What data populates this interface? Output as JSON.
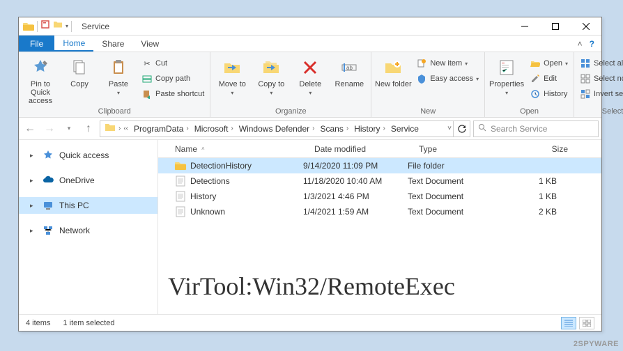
{
  "window": {
    "title": "Service"
  },
  "tabs": {
    "file": "File",
    "home": "Home",
    "share": "Share",
    "view": "View"
  },
  "ribbon": {
    "clipboard": {
      "label": "Clipboard",
      "pin": "Pin to Quick access",
      "copy": "Copy",
      "paste": "Paste",
      "cut": "Cut",
      "copypath": "Copy path",
      "pasteshortcut": "Paste shortcut"
    },
    "organize": {
      "label": "Organize",
      "moveto": "Move to",
      "copyto": "Copy to",
      "delete": "Delete",
      "rename": "Rename"
    },
    "new": {
      "label": "New",
      "newfolder": "New folder",
      "newitem": "New item",
      "easyaccess": "Easy access"
    },
    "open": {
      "label": "Open",
      "properties": "Properties",
      "open": "Open",
      "edit": "Edit",
      "history": "History"
    },
    "select": {
      "label": "Select",
      "selectall": "Select all",
      "selectnone": "Select none",
      "invert": "Invert selection"
    }
  },
  "breadcrumb": {
    "segments": [
      "ProgramData",
      "Microsoft",
      "Windows Defender",
      "Scans",
      "History",
      "Service"
    ]
  },
  "search": {
    "placeholder": "Search Service"
  },
  "nav": {
    "quickaccess": "Quick access",
    "onedrive": "OneDrive",
    "thispc": "This PC",
    "network": "Network"
  },
  "columns": {
    "name": "Name",
    "date": "Date modified",
    "type": "Type",
    "size": "Size"
  },
  "files": [
    {
      "name": "DetectionHistory",
      "date": "9/14/2020 11:09 PM",
      "type": "File folder",
      "size": "",
      "kind": "folder",
      "selected": true
    },
    {
      "name": "Detections",
      "date": "11/18/2020 10:40 AM",
      "type": "Text Document",
      "size": "1 KB",
      "kind": "txt",
      "selected": false
    },
    {
      "name": "History",
      "date": "1/3/2021 4:46 PM",
      "type": "Text Document",
      "size": "1 KB",
      "kind": "txt",
      "selected": false
    },
    {
      "name": "Unknown",
      "date": "1/4/2021 1:59 AM",
      "type": "Text Document",
      "size": "2 KB",
      "kind": "txt",
      "selected": false
    }
  ],
  "status": {
    "items": "4 items",
    "selected": "1 item selected"
  },
  "overlay": "VirTool:Win32/RemoteExec",
  "watermark": "2SPYWARE"
}
